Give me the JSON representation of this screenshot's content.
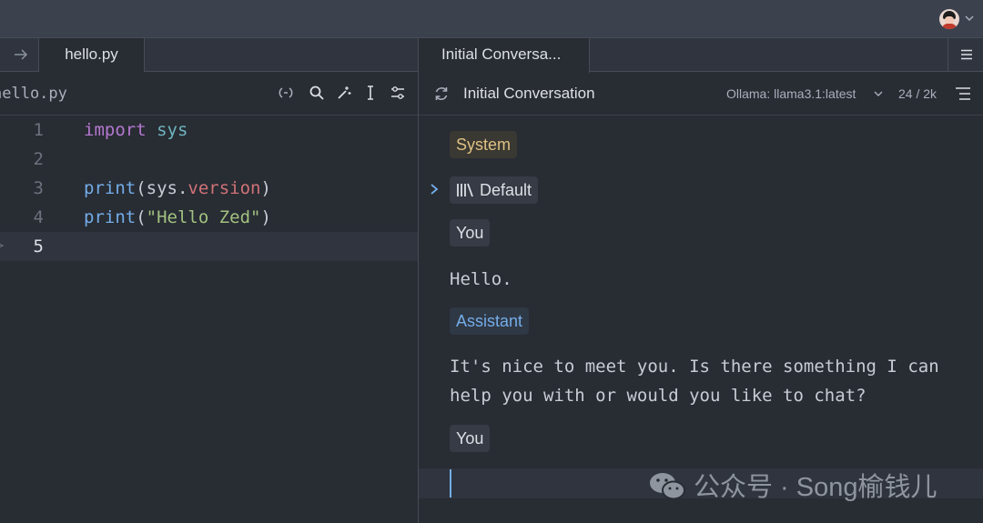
{
  "titlebar": {
    "avatar": "user-avatar",
    "menu_icon": "chevron-down-icon"
  },
  "left_pane": {
    "nav_icon": "arrow-right-icon",
    "tab_label": "hello.py",
    "breadcrumb": "hello.py",
    "toolbar_icons": [
      "inline-assist-icon",
      "search-icon",
      "sparkle-icon",
      "cursor-icon",
      "settings-sliders-icon"
    ],
    "active_line": 5,
    "code_lines": [
      {
        "num": "1",
        "tokens": [
          {
            "text": "import",
            "cls": "kw"
          },
          {
            "text": " ",
            "cls": ""
          },
          {
            "text": "sys",
            "cls": "mod"
          }
        ]
      },
      {
        "num": "2",
        "tokens": []
      },
      {
        "num": "3",
        "tokens": [
          {
            "text": "print",
            "cls": "fn"
          },
          {
            "text": "(sys.",
            "cls": ""
          },
          {
            "text": "version",
            "cls": "prop"
          },
          {
            "text": ")",
            "cls": ""
          }
        ]
      },
      {
        "num": "4",
        "tokens": [
          {
            "text": "print",
            "cls": "fn"
          },
          {
            "text": "(",
            "cls": ""
          },
          {
            "text": "\"Hello Zed\"",
            "cls": "str"
          },
          {
            "text": ")",
            "cls": ""
          }
        ]
      },
      {
        "num": "5",
        "tokens": []
      }
    ]
  },
  "right_pane": {
    "tab_label": "Initial Conversa...",
    "menu_icon": "hamburger-menu-icon",
    "header": {
      "refresh_icon": "refresh-icon",
      "title": "Initial Conversation",
      "model": "Ollama: llama3.1:latest",
      "tokens": "24 / 2k",
      "outline_icon": "outline-icon"
    },
    "messages": {
      "system_label": "System",
      "default_label": "Default",
      "you_label_1": "You",
      "user_text": "Hello.",
      "assistant_label": "Assistant",
      "assistant_text": "It's nice to meet you. Is there something I can help you with or would you like to chat?",
      "you_label_2": "You"
    }
  },
  "watermark": {
    "text": "公众号 · Song榆钱儿"
  },
  "colors": {
    "background": "#282c33",
    "accent": "#74ade8",
    "system": "#dec184",
    "keyword": "#b477cf",
    "string": "#a1c181"
  }
}
